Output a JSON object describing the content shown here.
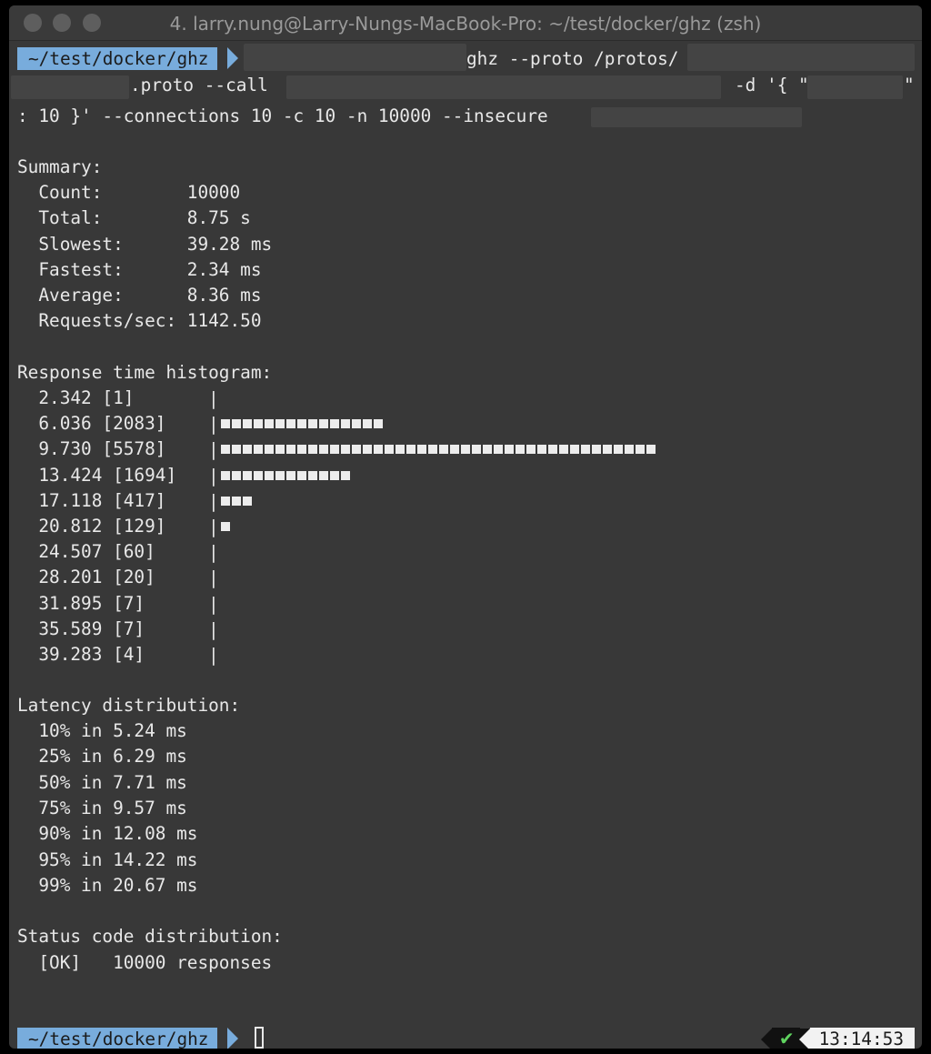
{
  "window": {
    "title": "4. larry.nung@Larry-Nungs-MacBook-Pro: ~/test/docker/ghz (zsh)"
  },
  "prompt": {
    "path": "~/test/docker/ghz"
  },
  "command": {
    "line1": "ghz --proto /protos/",
    "line2_a": ".proto --call",
    "line2_b": "-d '{ \"",
    "line2_c": "\"",
    "line3": ": 10 }' --connections 10 -c 10 -n 10000 --insecure"
  },
  "summary": {
    "heading": "Summary:",
    "rows": [
      "  Count:        10000",
      "  Total:        8.75 s",
      "  Slowest:      39.28 ms",
      "  Fastest:      2.34 ms",
      "  Average:      8.36 ms",
      "  Requests/sec: 1142.50"
    ]
  },
  "histogram": {
    "heading": "Response time histogram:",
    "rows": [
      {
        "label": "  2.342 [1]",
        "bar": 0
      },
      {
        "label": "  6.036 [2083]",
        "bar": 15
      },
      {
        "label": "  9.730 [5578]",
        "bar": 40
      },
      {
        "label": "  13.424 [1694]",
        "bar": 12
      },
      {
        "label": "  17.118 [417]",
        "bar": 3
      },
      {
        "label": "  20.812 [129]",
        "bar": 1
      },
      {
        "label": "  24.507 [60]",
        "bar": 0
      },
      {
        "label": "  28.201 [20]",
        "bar": 0
      },
      {
        "label": "  31.895 [7]",
        "bar": 0
      },
      {
        "label": "  35.589 [7]",
        "bar": 0
      },
      {
        "label": "  39.283 [4]",
        "bar": 0
      }
    ]
  },
  "latency": {
    "heading": "Latency distribution:",
    "rows": [
      "  10% in 5.24 ms",
      "  25% in 6.29 ms",
      "  50% in 7.71 ms",
      "  75% in 9.57 ms",
      "  90% in 12.08 ms",
      "  95% in 14.22 ms",
      "  99% in 20.67 ms"
    ]
  },
  "status": {
    "heading": "Status code distribution:",
    "rows": [
      "  [OK]   10000 responses"
    ]
  },
  "status_bar": {
    "check": "✔",
    "time": "13:14:53"
  },
  "colors": {
    "prompt_bg": "#78acdc",
    "check": "#5fd35f",
    "background": "#383838"
  }
}
